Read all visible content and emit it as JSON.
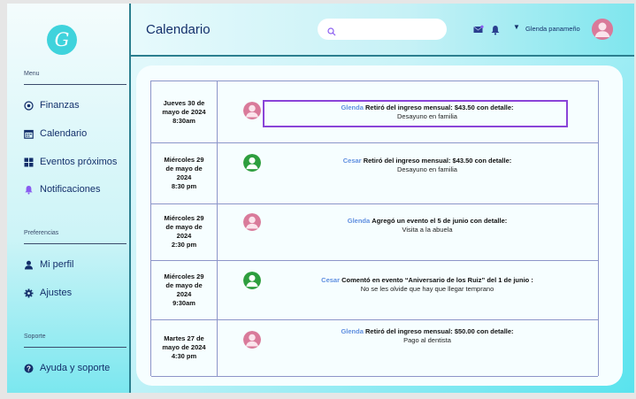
{
  "sidebar": {
    "menu_label": "Menu",
    "items": [
      {
        "label": "Finanzas",
        "icon": "finance-icon"
      },
      {
        "label": "Calendario",
        "icon": "calendar-icon"
      },
      {
        "label": "Eventos próximos",
        "icon": "grid-icon"
      },
      {
        "label": "Notificaciones",
        "icon": "bell-icon"
      }
    ],
    "preferences_label": "Preferencias",
    "pref_items": [
      {
        "label": "Mi perfil",
        "icon": "user-icon"
      },
      {
        "label": "Ajustes",
        "icon": "gear-icon"
      }
    ],
    "support_label": "Soporte",
    "support_items": [
      {
        "label": "Ayuda y soporte",
        "icon": "help-icon"
      }
    ],
    "logo_text": "G"
  },
  "header": {
    "title": "Calendario",
    "search_placeholder": "",
    "user_name": "Glenda panameño"
  },
  "feed": [
    {
      "date": "Jueves 30 de\nmayo de 2024\n8:30am",
      "actor": "Glenda",
      "action": "Retiró del ingreso mensual: $43.50 con detalle:",
      "detail": "Desayuno en familia",
      "avatar": "female"
    },
    {
      "date": "Miércoles 29\nde mayo de\n2024\n8:30 pm",
      "actor": "Cesar",
      "action": "Retiró del ingreso mensual: $43.50 con detalle:",
      "detail": "Desayuno en familia",
      "avatar": "male"
    },
    {
      "date": "Miércoles 29\nde mayo de\n2024\n2:30 pm",
      "actor": "Glenda",
      "action": "Agregó un evento el 5 de junio con detalle:",
      "detail": "Visita a la abuela",
      "avatar": "female"
    },
    {
      "date": "Miércoles 29\nde mayo de\n2024\n9:30am",
      "actor": "Cesar",
      "action": "Comentó en evento “Aniversario de los Ruiz” del 1 de junio :",
      "detail": "No se les olvide que hay que llegar temprano",
      "avatar": "male"
    },
    {
      "date": "Martes 27 de\nmayo de 2024\n4:30 pm",
      "actor": "Glenda",
      "action": "Retiró del ingreso mensual: $50.00 con detalle:",
      "detail": "Pago al dentista",
      "avatar": "female"
    }
  ],
  "colors": {
    "accent": "#3fd3dc",
    "female_avatar": "#d97a9a",
    "male_avatar": "#2e9e3e",
    "highlight": "#8a44d8"
  }
}
